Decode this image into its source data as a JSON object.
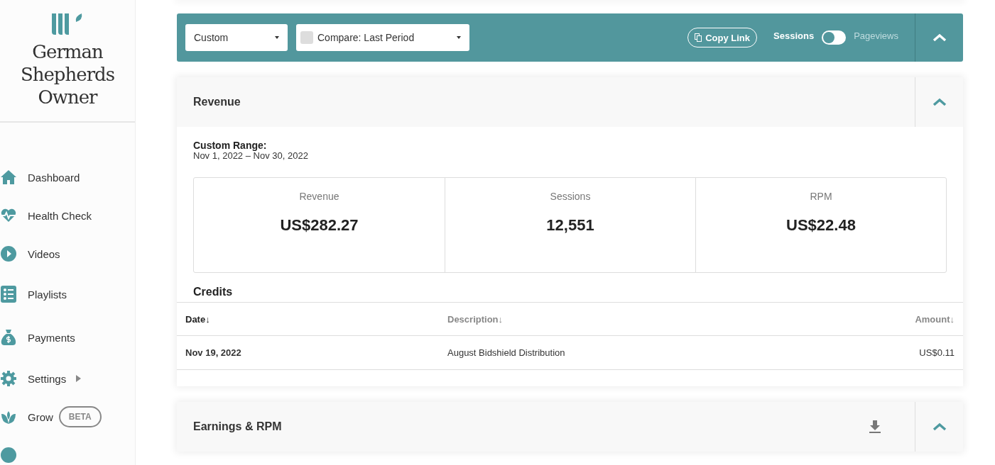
{
  "sidebar": {
    "site_name": "German Shepherds Owner",
    "items": [
      {
        "label": "Dashboard"
      },
      {
        "label": "Health Check"
      },
      {
        "label": "Videos"
      },
      {
        "label": "Playlists"
      },
      {
        "label": "Payments"
      },
      {
        "label": "Settings",
        "has_submenu": true
      },
      {
        "label": "Grow",
        "badge": "BETA"
      }
    ]
  },
  "toolbar": {
    "range_select": "Custom",
    "compare_select": "Compare: Last Period",
    "compare_checked": false,
    "copy_link": "Copy Link",
    "metric_options": [
      {
        "label": "Sessions",
        "selected": true
      },
      {
        "label": "Pageviews",
        "selected": false
      }
    ]
  },
  "revenue": {
    "title": "Revenue",
    "range_label": "Custom Range:",
    "range": "Nov 1, 2022 – Nov 30, 2022",
    "stats": [
      {
        "label": "Revenue",
        "value": "US$282.27"
      },
      {
        "label": "Sessions",
        "value": "12,551"
      },
      {
        "label": "RPM",
        "value": "US$22.48"
      }
    ],
    "credits_title": "Credits",
    "columns": [
      {
        "label": "Date↓",
        "active": true
      },
      {
        "label": "Description↓",
        "active": false
      },
      {
        "label": "Amount↓",
        "active": false
      }
    ],
    "rows": [
      [
        "Nov 19, 2022",
        "August Bidshield Distribution",
        "US$0.11"
      ]
    ]
  },
  "earnings": {
    "title": "Earnings & RPM"
  }
}
